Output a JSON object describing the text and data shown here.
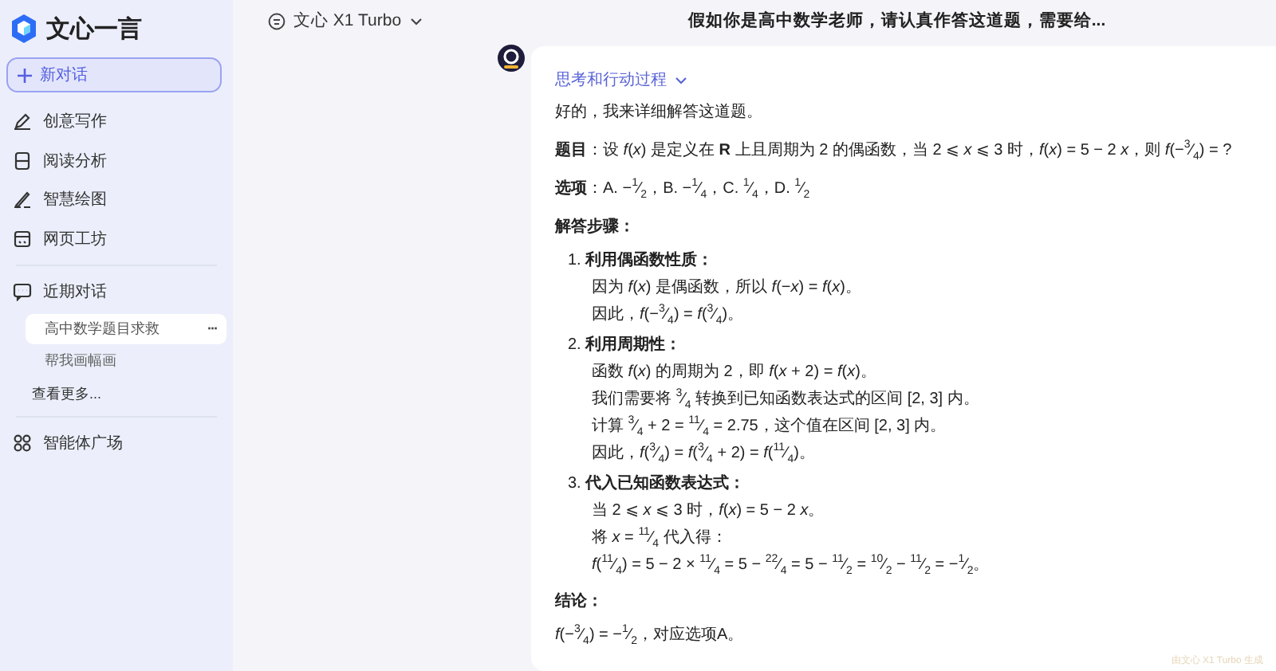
{
  "sidebar": {
    "logo_text": "文心一言",
    "new_chat": "新对话",
    "nav": [
      {
        "label": "创意写作"
      },
      {
        "label": "阅读分析"
      },
      {
        "label": "智慧绘图"
      },
      {
        "label": "网页工坊"
      }
    ],
    "recent": {
      "title": "近期对话",
      "items": [
        {
          "label": "高中数学题目求救",
          "selected": true,
          "menu": "···"
        },
        {
          "label": "帮我画幅画",
          "selected": false
        }
      ],
      "more": "查看更多..."
    },
    "agents": "智能体广场"
  },
  "header": {
    "model": "文心 X1 Turbo",
    "title": "假如你是高中数学老师，请认真作答这道题，需要给..."
  },
  "answer": {
    "thinking_label": "思考和行动过程",
    "blocks": [
      {
        "kind": "para",
        "text": "好的，我来详细解答这道题。"
      },
      {
        "kind": "para",
        "text": "**题目**：设 *f*(*x*) 是定义在 **R** 上且周期为 2 的偶函数，当 2 ⩽ *x* ⩽ 3 时，*f*(*x*) = 5 − 2 *x*，则 *f*(−$^{3}$⁄$_{4}$) = ?"
      },
      {
        "kind": "para",
        "text": "**选项**：A. −$^{1}$⁄$_{2}$，B. −$^{1}$⁄$_{4}$，C. $^{1}$⁄$_{4}$，D. $^{1}$⁄$_{2}$"
      },
      {
        "kind": "heading",
        "text": "解答步骤："
      },
      {
        "kind": "steps",
        "items": [
          {
            "number": "1.",
            "title": "利用偶函数性质：",
            "lines": [
              "因为 *f*(*x*) 是偶函数，所以 *f*(−*x*) = *f*(*x*)。",
              "因此，*f*(−$^{3}$⁄$_{4}$) = *f*($^{3}$⁄$_{4}$)。"
            ]
          },
          {
            "number": "2.",
            "title": "利用周期性：",
            "lines": [
              "函数 *f*(*x*) 的周期为 2，即 *f*(*x* + 2) = *f*(*x*)。",
              "我们需要将 $^{3}$⁄$_{4}$ 转换到已知函数表达式的区间 [2, 3] 内。",
              "计算 $^{3}$⁄$_{4}$ + 2 = $^{11}$⁄$_{4}$ = 2.75，这个值在区间 [2, 3] 内。",
              "因此，*f*($^{3}$⁄$_{4}$) = *f*($^{3}$⁄$_{4}$ + 2) = *f*($^{11}$⁄$_{4}$)。"
            ]
          },
          {
            "number": "3.",
            "title": "代入已知函数表达式：",
            "lines": [
              "当 2 ⩽ *x* ⩽ 3 时，*f*(*x*) = 5 − 2 *x*。",
              "将 *x* = $^{11}$⁄$_{4}$ 代入得：",
              "*f*($^{11}$⁄$_{4}$) = 5 − 2 × $^{11}$⁄$_{4}$ = 5 − $^{22}$⁄$_{4}$ = 5 − $^{11}$⁄$_{2}$ = $^{10}$⁄$_{2}$ − $^{11}$⁄$_{2}$ = −$^{1}$⁄$_{2}$。"
            ]
          }
        ]
      },
      {
        "kind": "heading",
        "text": "结论："
      },
      {
        "kind": "para",
        "text": "*f*(−$^{3}$⁄$_{4}$) = −$^{1}$⁄$_{2}$，对应选项A。"
      }
    ],
    "footer_mark": "由文心 X1 Turbo 生成"
  }
}
